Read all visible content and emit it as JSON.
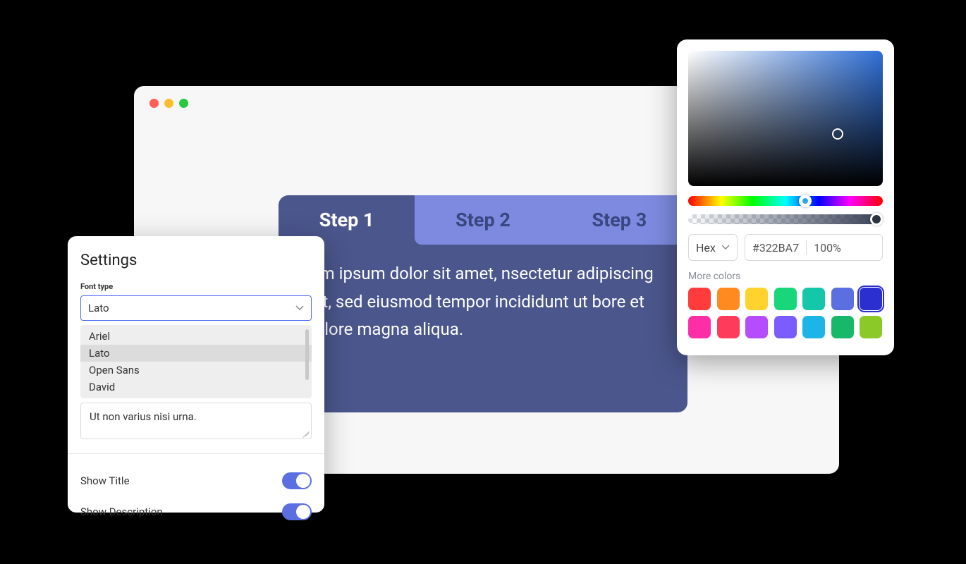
{
  "steps": {
    "tabs": [
      "Step 1",
      "Step 2",
      "Step 3"
    ],
    "activeIndex": 0,
    "body": "rem ipsum dolor sit amet, nsectetur adipiscing elit, sed eiusmod tempor incididunt ut bore et dolore magna aliqua."
  },
  "settings": {
    "title": "Settings",
    "font_type_label": "Font type",
    "font_selected": "Lato",
    "font_options": [
      "Ariel",
      "Lato",
      "Open Sans",
      "David"
    ],
    "textarea_value": "Ut non varius nisi urna.",
    "show_title_label": "Show Title",
    "show_title": true,
    "show_description_label": "Show Description",
    "show_description": true
  },
  "picker": {
    "format": "Hex",
    "hex": "#322BA7",
    "opacity": "100%",
    "more_label": "More colors",
    "swatches": [
      "#ff3b3b",
      "#ff8a1f",
      "#ffd22e",
      "#19d67a",
      "#14c7a8",
      "#5b6fe0",
      "#2b2fd0",
      "#ff2ea6",
      "#ff3b5c",
      "#b54dff",
      "#7a5cff",
      "#1db4e6",
      "#18b86b",
      "#8ac926"
    ],
    "selected_swatch_index": 6
  }
}
